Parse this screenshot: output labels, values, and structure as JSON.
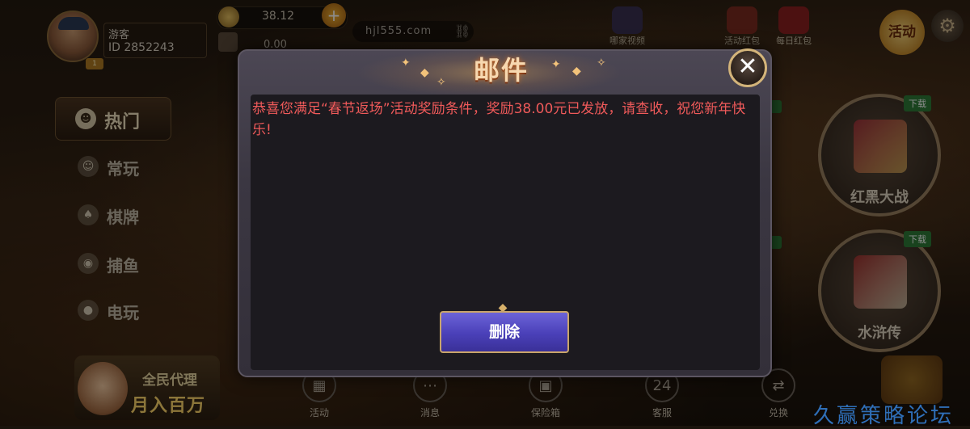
{
  "user": {
    "name": "游客",
    "id": "ID 2852243",
    "vip": "1"
  },
  "wallet": {
    "coins": "38.12",
    "bank": "0.00",
    "plus": "+"
  },
  "site_url": "hjl555.com",
  "top_icons": [
    {
      "label": "哪家视频",
      "icon": "video-icon"
    },
    {
      "label": "活动红包",
      "icon": "red-envelope-icon"
    },
    {
      "label": "每日红包",
      "icon": "daily-envelope-icon"
    }
  ],
  "activity_label": "活动",
  "sidebar": {
    "hot": "热门",
    "items": [
      "常玩",
      "棋牌",
      "捕鱼",
      "电玩"
    ]
  },
  "promo": {
    "line1": "全民代理",
    "line2": "月入百万"
  },
  "games": [
    {
      "name": "红黑大战",
      "tag": "下载"
    },
    {
      "name": "水浒传",
      "tag": "下载"
    }
  ],
  "bottom_nav": [
    "活动",
    "消息",
    "保险箱",
    "客服",
    "兑换"
  ],
  "bottom_nav_icons": [
    "▦",
    "⋯",
    "▣",
    "24",
    "⇄"
  ],
  "modal": {
    "title": "邮件",
    "close": "✕",
    "message": "恭喜您满足“春节返场”活动奖励条件，奖励38.00元已发放，请查收，祝您新年快乐!",
    "delete_label": "删除"
  },
  "watermark": "久赢策略论坛",
  "colors": {
    "message_text": "#f05a5a",
    "delete_button": "#5a50c8",
    "title_glow": "#f3c37a"
  }
}
